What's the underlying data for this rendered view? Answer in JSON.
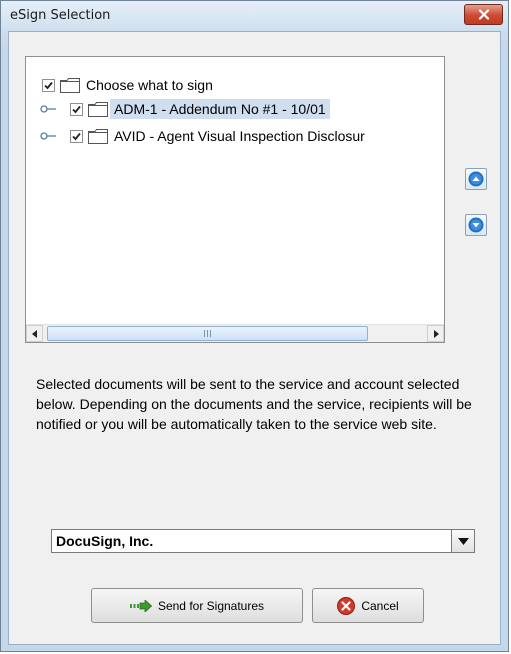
{
  "window": {
    "title": "eSign Selection"
  },
  "tree": {
    "root": {
      "label": "Choose what to sign",
      "checked": true
    },
    "items": [
      {
        "label": "ADM-1 - Addendum No #1 - 10/01",
        "checked": true,
        "selected": true
      },
      {
        "label": "AVID - Agent Visual Inspection Disclosur",
        "checked": true,
        "selected": false
      }
    ]
  },
  "info_text": "Selected documents will be sent to the service and account selected below. Depending on the documents and the service, recipients will be notified or you will be automatically taken to the service web site.",
  "service_combo": {
    "value": "DocuSign, Inc."
  },
  "buttons": {
    "send_label": "Send for Signatures",
    "cancel_label": "Cancel"
  },
  "icons": {
    "close": "close-icon",
    "move_up": "arrow-up-icon",
    "move_down": "arrow-down-icon",
    "send": "send-arrow-icon",
    "cancel": "cancel-x-icon"
  },
  "colors": {
    "accent": "#1f6fc4",
    "close_red": "#c23a22",
    "cancel_red": "#d03a2a",
    "send_green": "#3d9a2c"
  }
}
